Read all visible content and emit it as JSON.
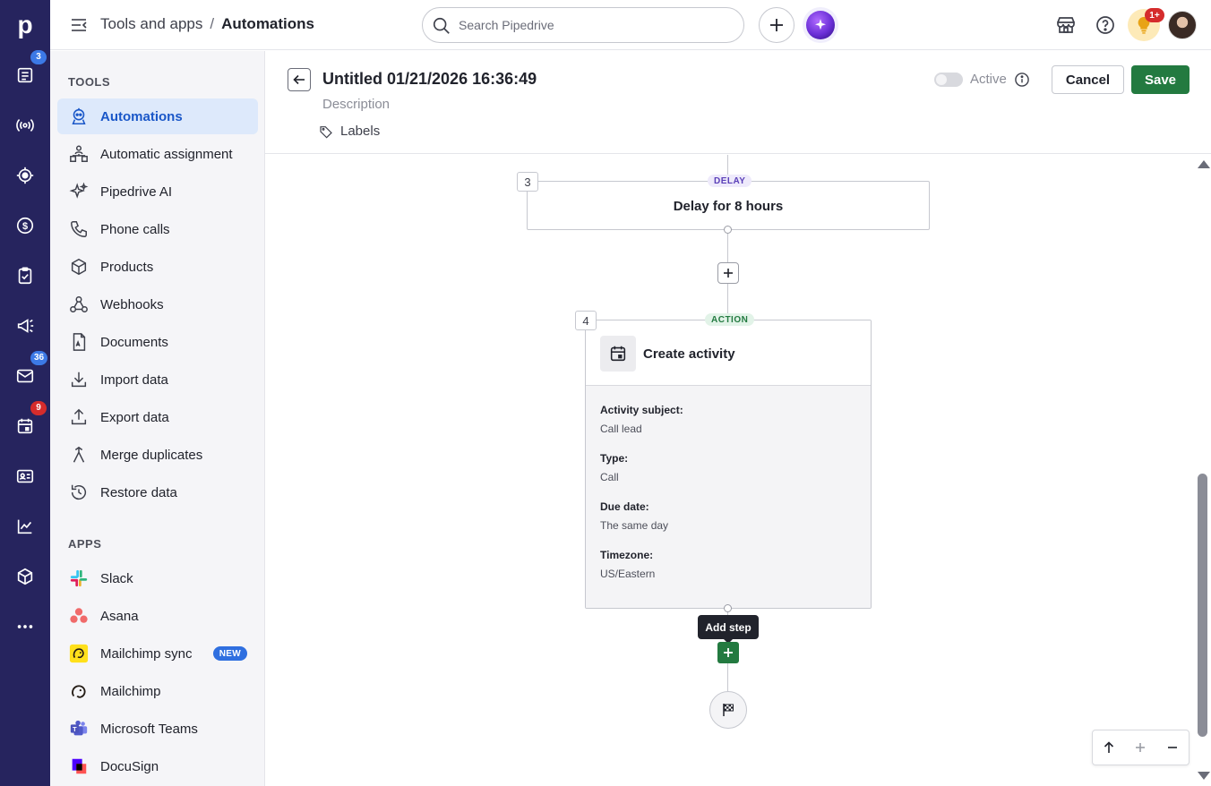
{
  "rail": {
    "logo": "p",
    "badges": {
      "leads": "3",
      "mail": "36",
      "calendar": "9"
    }
  },
  "topbar": {
    "breadcrumb_parent": "Tools and apps",
    "breadcrumb_sep": "/",
    "breadcrumb_current": "Automations",
    "search_placeholder": "Search Pipedrive",
    "notifications_badge": "1+"
  },
  "sidebar": {
    "tools_title": "TOOLS",
    "tools": [
      {
        "label": "Automations",
        "icon": "automations-icon"
      },
      {
        "label": "Automatic assignment",
        "icon": "assignment-icon"
      },
      {
        "label": "Pipedrive AI",
        "icon": "sparkle-icon"
      },
      {
        "label": "Phone calls",
        "icon": "phone-icon"
      },
      {
        "label": "Products",
        "icon": "box-icon"
      },
      {
        "label": "Webhooks",
        "icon": "webhook-icon"
      },
      {
        "label": "Documents",
        "icon": "document-icon"
      },
      {
        "label": "Import data",
        "icon": "import-icon"
      },
      {
        "label": "Export data",
        "icon": "export-icon"
      },
      {
        "label": "Merge duplicates",
        "icon": "merge-icon"
      },
      {
        "label": "Restore data",
        "icon": "restore-icon"
      }
    ],
    "apps_title": "APPS",
    "apps": [
      {
        "label": "Slack",
        "icon": "slack-icon"
      },
      {
        "label": "Asana",
        "icon": "asana-icon"
      },
      {
        "label": "Mailchimp sync",
        "icon": "mailchimp-icon",
        "badge": "NEW"
      },
      {
        "label": "Mailchimp",
        "icon": "mailchimp-icon"
      },
      {
        "label": "Microsoft Teams",
        "icon": "teams-icon"
      },
      {
        "label": "DocuSign",
        "icon": "docusign-icon"
      }
    ]
  },
  "header": {
    "title": "Untitled 01/21/2026 16:36:49",
    "description_placeholder": "Description",
    "labels": "Labels",
    "active_label": "Active",
    "cancel": "Cancel",
    "save": "Save"
  },
  "flow": {
    "delay_step": {
      "number": "3",
      "tag": "DELAY",
      "text": "Delay for 8 hours"
    },
    "action_step": {
      "number": "4",
      "tag": "ACTION",
      "title": "Create activity",
      "fields": [
        {
          "label": "Activity subject:",
          "value": "Call lead"
        },
        {
          "label": "Type:",
          "value": "Call"
        },
        {
          "label": "Due date:",
          "value": "The same day"
        },
        {
          "label": "Timezone:",
          "value": "US/Eastern"
        }
      ]
    },
    "tooltip": "Add step"
  },
  "colors": {
    "rail_bg": "#26245e",
    "save_green": "#237a40",
    "active_blue": "#1a57c8"
  }
}
